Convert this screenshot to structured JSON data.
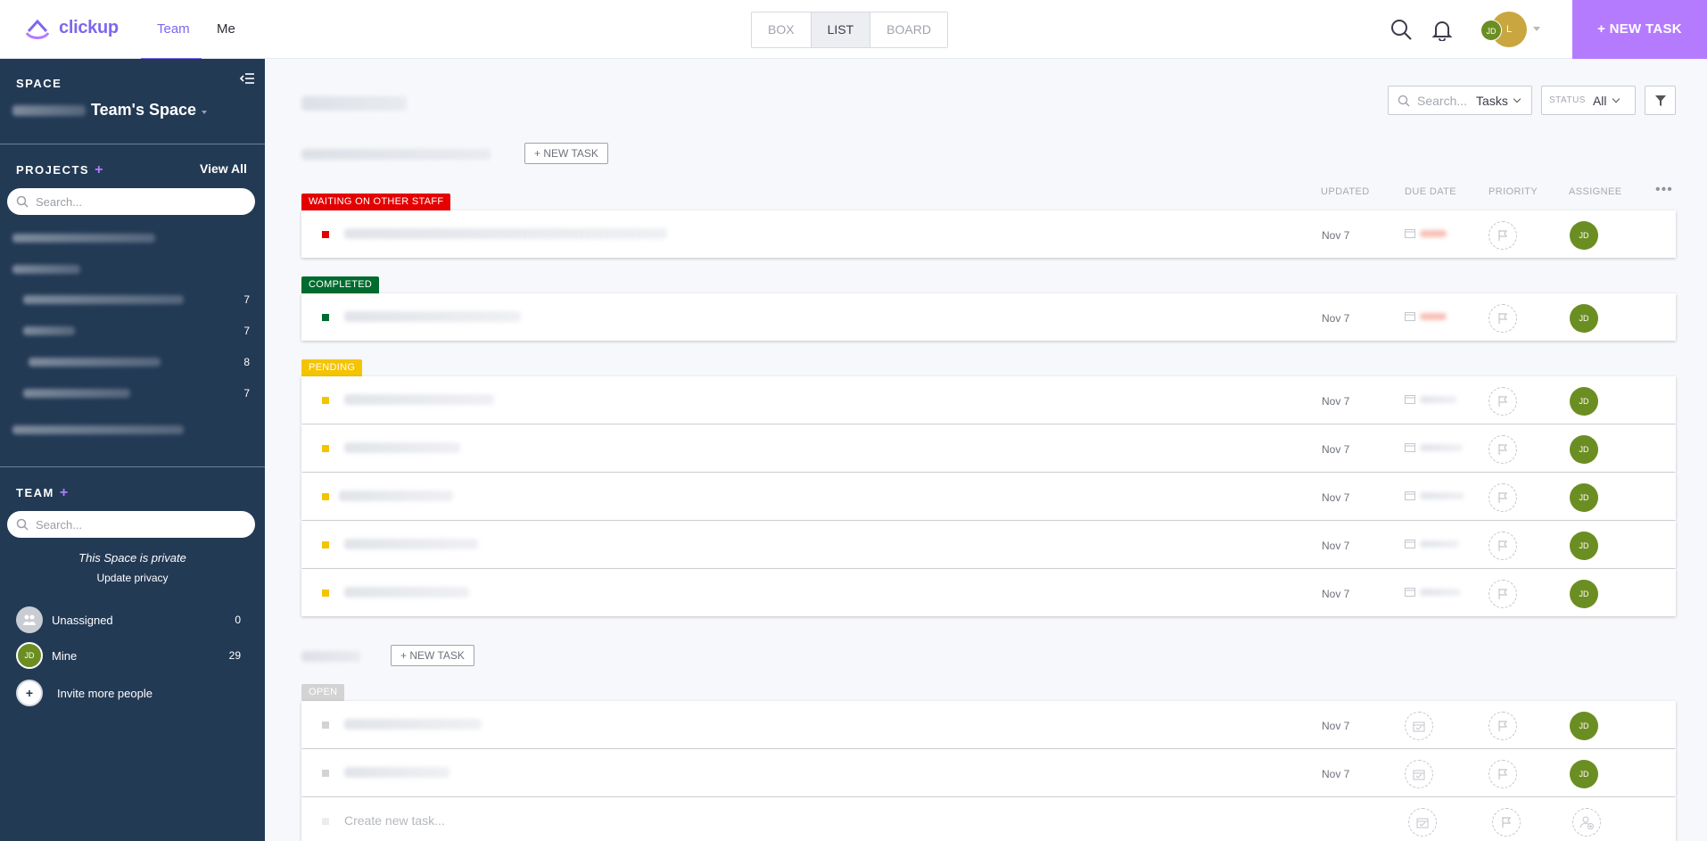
{
  "app": {
    "logo_text": "clickup",
    "brand_color": "#7b68ee",
    "accent_color": "#b57bff"
  },
  "header": {
    "nav": {
      "team": "Team",
      "me": "Me"
    },
    "views": [
      "BOX",
      "LIST",
      "BOARD"
    ],
    "active_view": "LIST",
    "user_initials": "JD",
    "user_initials_back": "L",
    "new_task_label": "+ NEW TASK"
  },
  "sidebar": {
    "space_label": "SPACE",
    "space_name": "Team's Space",
    "projects_label": "PROJECTS",
    "view_all": "View All",
    "projects_search_placeholder": "Search...",
    "project_counts": [
      "7",
      "7",
      "8",
      "7"
    ],
    "team_label": "TEAM",
    "team_search_placeholder": "Search...",
    "private_note": "This Space is private",
    "update_privacy": "Update privacy",
    "members": [
      {
        "name": "Unassigned",
        "count": "0"
      },
      {
        "name": "Mine",
        "count": "29",
        "initials": "JD"
      },
      {
        "name": "Invite more people"
      }
    ]
  },
  "toolbar": {
    "search_placeholder": "Search...",
    "search_scope": "Tasks",
    "status_label": "STATUS",
    "status_value": "All"
  },
  "list": {
    "new_task_small": "+ NEW TASK",
    "columns": {
      "updated": "UPDATED",
      "due_date": "DUE DATE",
      "priority": "PRIORITY",
      "assignee": "ASSIGNEE"
    },
    "groups": [
      {
        "status": "WAITING ON OTHER STAFF",
        "color": "#e50000",
        "tasks": [
          {
            "updated": "Nov 7",
            "assignee": "JD"
          }
        ]
      },
      {
        "status": "COMPLETED",
        "color": "#006b2e",
        "tasks": [
          {
            "updated": "Nov 7",
            "assignee": "JD"
          }
        ]
      },
      {
        "status": "PENDING",
        "color": "#f5c400",
        "tasks": [
          {
            "updated": "Nov 7",
            "assignee": "JD"
          },
          {
            "updated": "Nov 7",
            "assignee": "JD"
          },
          {
            "updated": "Nov 7",
            "assignee": "JD"
          },
          {
            "updated": "Nov 7",
            "assignee": "JD"
          },
          {
            "updated": "Nov 7",
            "assignee": "JD"
          }
        ]
      }
    ]
  },
  "list2": {
    "new_task_small": "+ NEW TASK",
    "groups": [
      {
        "status": "OPEN",
        "color": "#d3d3d3",
        "tasks": [
          {
            "updated": "Nov 7",
            "assignee": "JD"
          },
          {
            "updated": "Nov 7",
            "assignee": "JD"
          }
        ]
      }
    ],
    "create_placeholder": "Create new task..."
  },
  "icons": [
    "logo-icon",
    "search-icon",
    "bell-icon",
    "collapse-sidebar-icon",
    "filter-icon",
    "calendar-icon",
    "flag-icon",
    "add-assignee-icon",
    "more-icon"
  ]
}
